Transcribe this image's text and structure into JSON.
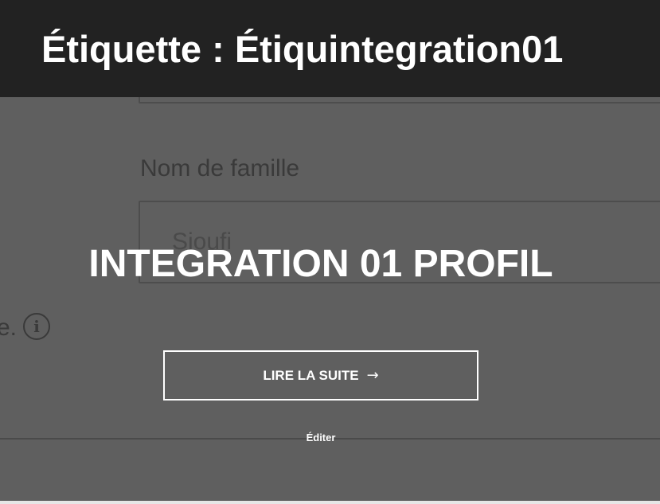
{
  "header": {
    "title": "Étiquette : Étiquintegration01"
  },
  "background_form": {
    "label": "Nom de famille",
    "field_value": "Sioufi",
    "hint_fragment": "e.",
    "info_icon": "info-icon"
  },
  "post": {
    "title": "INTEGRATION 01 PROFIL",
    "read_more_label": "LIRE LA SUITE",
    "read_more_arrow": "→",
    "edit_label": "Éditer"
  },
  "colors": {
    "header_bg": "#222222",
    "overlay_bg": "#5f5f5f",
    "text": "#ffffff"
  }
}
